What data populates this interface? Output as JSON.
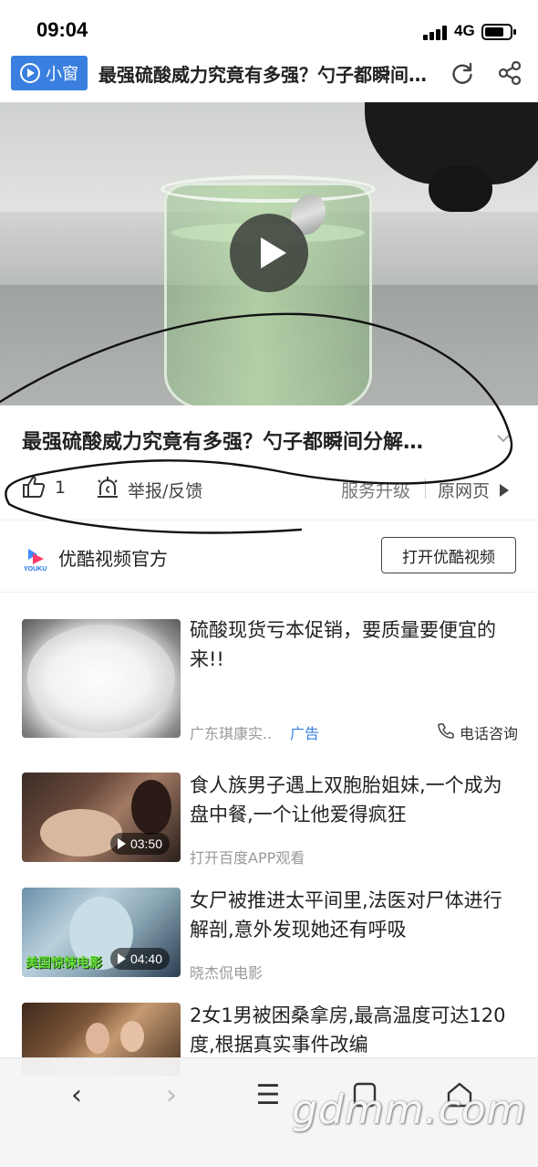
{
  "status_bar": {
    "time": "09:04",
    "network": "4G",
    "battery_level": 0.75
  },
  "nav": {
    "mini_window_label": "小窗",
    "title": "最强硫酸威力究竟有多强？勺子都瞬间分解…",
    "icons": [
      "play-icon",
      "refresh-icon",
      "share-icon"
    ]
  },
  "video": {
    "title": "最强硫酸威力究竟有多强？勺子都瞬间分解…"
  },
  "actions": {
    "like_count": "1",
    "report_label": "举报/反馈",
    "upgrade_label": "服务升级",
    "origin_label": "原网页"
  },
  "source": {
    "logo_text": "YOUKU",
    "name": "优酷视频官方",
    "open_button": "打开优酷视频"
  },
  "feed": [
    {
      "title": "硫酸现货亏本促销，要质量要便宜的来!!",
      "meta": "广东琪康实..",
      "ad_tag": "广告",
      "phone_label": "电话咨询"
    },
    {
      "title": "食人族男子遇上双胞胎姐妹,一个成为盘中餐,一个让他爱得疯狂",
      "meta": "打开百度APP观看",
      "duration": "03:50"
    },
    {
      "title": "女尸被推进太平间里,法医对尸体进行解剖,意外发现她还有呼吸",
      "meta": "晓杰侃电影",
      "duration": "04:40",
      "thumb_label": "美国惊悚电影"
    },
    {
      "title": "2女1男被困桑拿房,最高温度可达120度,根据真实事件改编"
    }
  ],
  "toolbar": {
    "back": "‹",
    "forward": "›",
    "menu": "☰"
  },
  "watermark": "gdmm.com",
  "colors": {
    "accent": "#3a7fe0",
    "ad_blue": "#3a7fe0",
    "text": "#222222",
    "muted": "#999999"
  }
}
